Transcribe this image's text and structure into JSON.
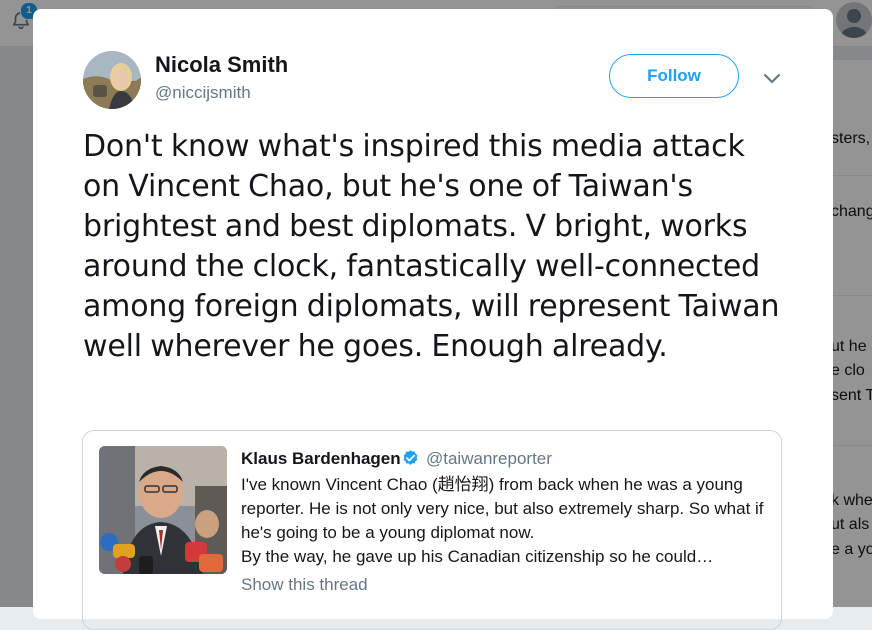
{
  "topbar": {
    "notification_count": "1"
  },
  "background_right_column": {
    "fragments": [
      "sters,",
      "chang",
      "ut he",
      "e clo",
      "sent T",
      "k whe",
      "ut als",
      "e a yo"
    ]
  },
  "tweet": {
    "author": {
      "name": "Nicola Smith",
      "handle": "@niccijsmith"
    },
    "follow_label": "Follow",
    "text": "Don't know what's inspired this media attack on Vincent Chao, but he's one of Taiwan's brightest and best diplomats. V bright, works around the clock, fantastically well-connected among foreign diplomats, will represent Taiwan well wherever he goes. Enough already."
  },
  "quoted_tweet": {
    "author_name": "Klaus Bardenhagen",
    "verified": true,
    "handle": "@taiwanreporter",
    "text": "I've known Vincent Chao (趙怡翔) from back when he was a young reporter. He is not only very nice, but also extremely sharp. So what if he's going to be a young diplomat now.\nBy the way, he gave up his Canadian citizenship so he could…",
    "show_thread_label": "Show this thread"
  },
  "colors": {
    "accent": "#1da1f2",
    "secondary_text": "#657786",
    "primary_text": "#14171a",
    "border": "#ccd6dd"
  },
  "icons": {
    "notifications": "bell-icon",
    "verified": "verified-badge-icon",
    "menu": "chevron-down-icon"
  }
}
